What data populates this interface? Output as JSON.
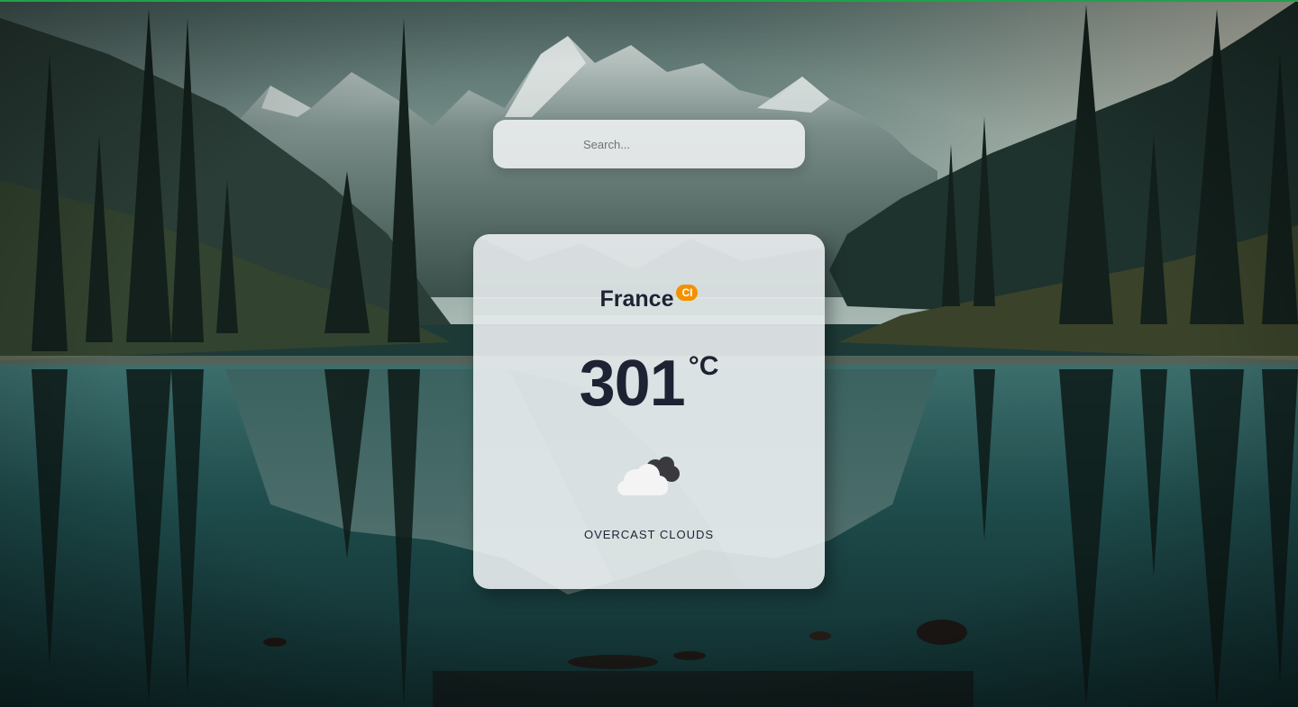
{
  "search": {
    "placeholder": "Search...",
    "value": ""
  },
  "weather": {
    "city": "France",
    "country_code": "CI",
    "temperature": "301",
    "unit": "°C",
    "condition": "OVERCAST CLOUDS",
    "icon": "overcast-clouds-icon"
  },
  "colors": {
    "badge": "#f39200",
    "text": "#1d2333",
    "card": "#f5f7f9",
    "top_line": "#22a04b"
  }
}
